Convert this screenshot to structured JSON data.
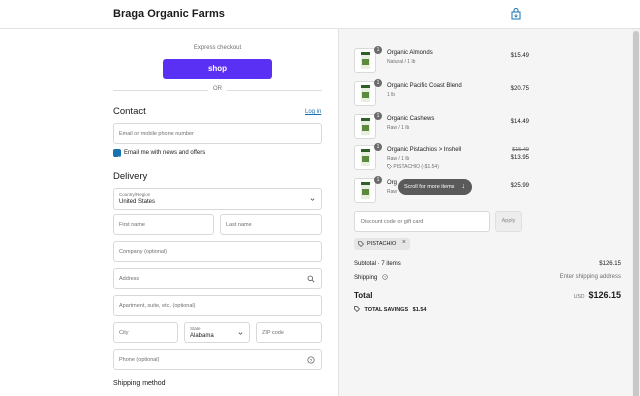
{
  "header": {
    "store_name": "Braga Organic Farms"
  },
  "express": {
    "label": "Express checkout",
    "shop_button": "shop",
    "or": "OR"
  },
  "contact": {
    "title": "Contact",
    "login": "Log in",
    "email_placeholder": "Email or mobile phone number",
    "news_label": "Email me with news and offers",
    "news_checked": true
  },
  "delivery": {
    "title": "Delivery",
    "country_label": "Country/Region",
    "country_value": "United States",
    "first_name": "First name",
    "last_name": "Last name",
    "company": "Company (optional)",
    "address": "Address",
    "apartment": "Apartment, suite, etc. (optional)",
    "city": "City",
    "state_label": "State",
    "state_value": "Alabama",
    "zip": "ZIP code",
    "phone": "Phone (optional)",
    "shipping_method": "Shipping method"
  },
  "cart": {
    "items": [
      {
        "qty": "1",
        "name": "Organic Almonds",
        "variant": "Natural / 1 lb",
        "price": "$15.49"
      },
      {
        "qty": "1",
        "name": "Organic Pacific Coast Blend",
        "variant": "1 lb",
        "price": "$20.75"
      },
      {
        "qty": "1",
        "name": "Organic Cashews",
        "variant": "Raw / 1 lb",
        "price": "$14.49"
      },
      {
        "qty": "1",
        "name": "Organic Pistachios > Inshell",
        "variant": "Raw / 1 lb",
        "discount": "PISTACHIO (-$1.54)",
        "old_price": "$15.49",
        "price": "$13.95"
      },
      {
        "qty": "1",
        "name": "Org",
        "variant": "Raw",
        "price": "$25.99"
      }
    ],
    "scroll_hint": "Scroll for more items",
    "discount_placeholder": "Discount code or gift card",
    "apply": "Apply",
    "applied_code": "PISTACHIO",
    "subtotal_label": "Subtotal · 7 items",
    "subtotal_value": "$126.15",
    "shipping_label": "Shipping",
    "shipping_value": "Enter shipping address",
    "total_label": "Total",
    "currency": "USD",
    "total_value": "$126.15",
    "savings_label": "TOTAL SAVINGS",
    "savings_value": "$1.54"
  },
  "colors": {
    "shop_purple": "#5a31f4",
    "link_blue": "#1773b0"
  }
}
